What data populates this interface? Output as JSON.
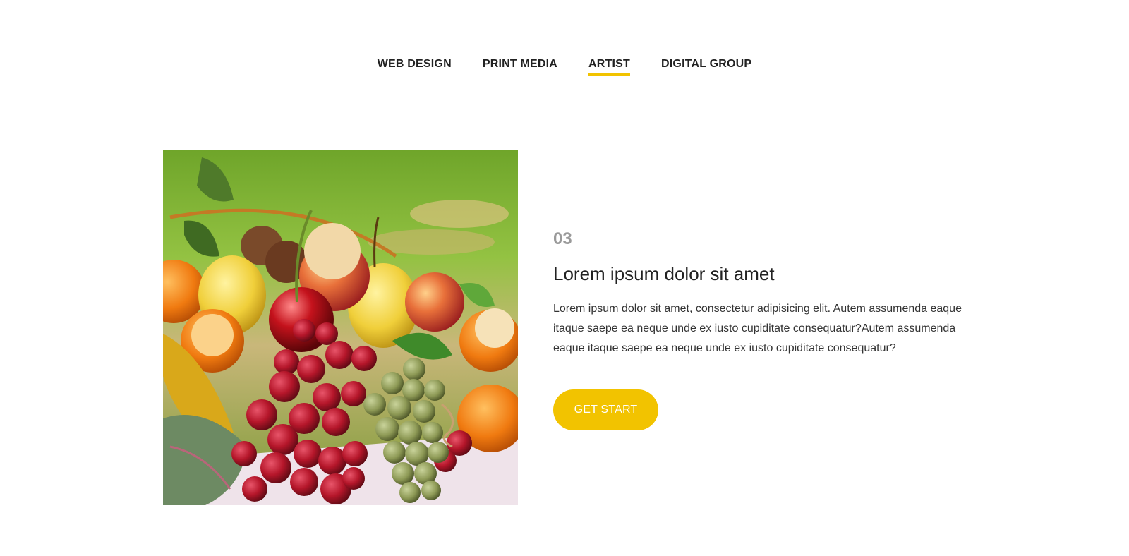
{
  "tabs": {
    "items": [
      {
        "label": "WEB DESIGN"
      },
      {
        "label": "PRINT MEDIA"
      },
      {
        "label": "ARTIST"
      },
      {
        "label": "DIGITAL GROUP"
      }
    ],
    "active_index": 2
  },
  "content": {
    "number": "03",
    "title": "Lorem ipsum dolor sit amet",
    "description": "Lorem ipsum dolor sit amet, consectetur adipisicing elit. Autem assumenda eaque itaque saepe ea neque unde ex iusto cupiditate consequatur?Autem assumenda eaque itaque saepe ea neque unde ex iusto cupiditate consequatur?",
    "cta_label": "GET START"
  },
  "colors": {
    "accent": "#f2c300",
    "number_gray": "#9a9a9a",
    "text": "#222222"
  }
}
